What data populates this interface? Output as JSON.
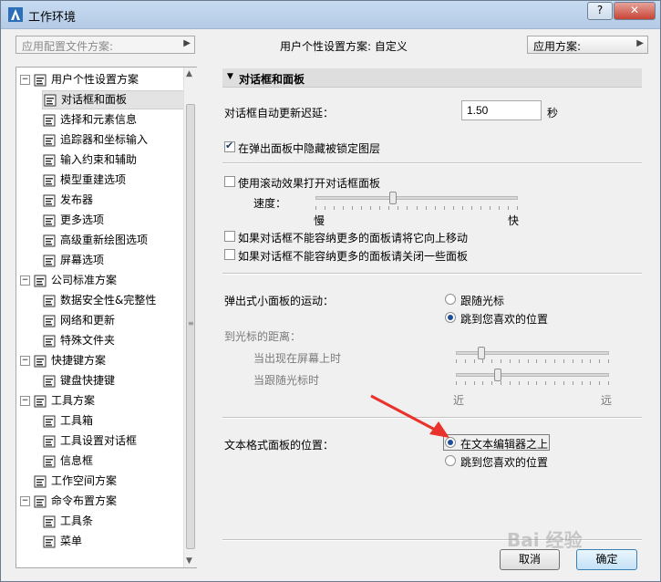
{
  "window": {
    "title": "工作环境",
    "help_label": "?",
    "close_label": "✕"
  },
  "header": {
    "profile_dropdown_placeholder": "应用配置文件方案:",
    "user_scheme_text": "用户个性设置方案:  自定义",
    "apply_scheme_label": "应用方案:"
  },
  "tree": {
    "items": [
      {
        "label": "用户个性设置方案",
        "level": 0,
        "expander": "−",
        "icon": "user-scheme-icon"
      },
      {
        "label": "对话框和面板",
        "level": 1,
        "icon": "dialog-panel-icon",
        "selected": true
      },
      {
        "label": "选择和元素信息",
        "level": 1,
        "icon": "selection-info-icon"
      },
      {
        "label": "追踪器和坐标输入",
        "level": 1,
        "icon": "xyz-tracker-icon"
      },
      {
        "label": "输入约束和辅助",
        "level": 1,
        "icon": "mouse-input-icon"
      },
      {
        "label": "模型重建选项",
        "level": 1,
        "icon": "model-rebuild-icon"
      },
      {
        "label": "发布器",
        "level": 1,
        "icon": "publisher-icon"
      },
      {
        "label": "更多选项",
        "level": 1,
        "icon": "more-options-icon"
      },
      {
        "label": "高级重新绘图选项",
        "level": 1,
        "icon": "redraw-options-icon"
      },
      {
        "label": "屏幕选项",
        "level": 1,
        "icon": "screen-options-icon"
      },
      {
        "label": "公司标准方案",
        "level": 0,
        "expander": "−",
        "icon": "company-scheme-icon"
      },
      {
        "label": "数据安全性&完整性",
        "level": 1,
        "icon": "data-safety-icon"
      },
      {
        "label": "网络和更新",
        "level": 1,
        "icon": "globe-icon"
      },
      {
        "label": "特殊文件夹",
        "level": 1,
        "icon": "special-folder-icon"
      },
      {
        "label": "快捷键方案",
        "level": 0,
        "expander": "−",
        "icon": "shortcut-scheme-icon"
      },
      {
        "label": "键盘快捷键",
        "level": 1,
        "icon": "keyboard-shortcut-icon"
      },
      {
        "label": "工具方案",
        "level": 0,
        "expander": "−",
        "icon": "tool-scheme-icon"
      },
      {
        "label": "工具箱",
        "level": 1,
        "icon": "toolbox-icon"
      },
      {
        "label": "工具设置对话框",
        "level": 1,
        "icon": "tool-settings-icon"
      },
      {
        "label": "信息框",
        "level": 1,
        "icon": "info-box-icon"
      },
      {
        "label": "工作空间方案",
        "level": 0,
        "icon": "workspace-scheme-icon"
      },
      {
        "label": "命令布置方案",
        "level": 0,
        "expander": "−",
        "icon": "command-layout-icon"
      },
      {
        "label": "工具条",
        "level": 1,
        "icon": "toolbar-icon"
      },
      {
        "label": "菜单",
        "level": 1,
        "icon": "menu-icon"
      }
    ]
  },
  "panel": {
    "section_title": "对话框和面板",
    "update_delay": {
      "label": "对话框自动更新迟延：",
      "value": "1.50",
      "unit": "秒"
    },
    "hide_locked_layers": {
      "label": "在弹出面板中隐藏被锁定图层",
      "checked": true
    },
    "scroll_effect": {
      "label": "使用滚动效果打开对话框面板",
      "checked": false
    },
    "speed": {
      "label": "速度：",
      "min_label": "慢",
      "max_label": "快",
      "value": 0.38
    },
    "move_up_option": {
      "label": "如果对话框不能容纳更多的面板请将它向上移动",
      "checked": false
    },
    "close_panels_option": {
      "label": "如果对话框不能容纳更多的面板请关闭一些面板",
      "checked": false
    },
    "popup_motion": {
      "label": "弹出式小面板的运动：",
      "options": [
        "跟随光标",
        "跳到您喜欢的位置"
      ],
      "selected": 1
    },
    "cursor_distance": {
      "label": "到光标的距离：",
      "first_label": "当出现在屏幕上时",
      "follow_label": "当跟随光标时",
      "first_value": 0.16,
      "follow_value": 0.27,
      "near_label": "近",
      "far_label": "远"
    },
    "text_panel_position": {
      "label": "文本格式面板的位置：",
      "options": [
        "在文本编辑器之上",
        "跳到您喜欢的位置"
      ],
      "selected": 0
    }
  },
  "buttons": {
    "cancel": "取消",
    "ok": "确定"
  },
  "watermark": "Bai 经验",
  "colors": {
    "annotation_arrow": "#e8322b",
    "selected_radio": "#1d4e9c"
  }
}
